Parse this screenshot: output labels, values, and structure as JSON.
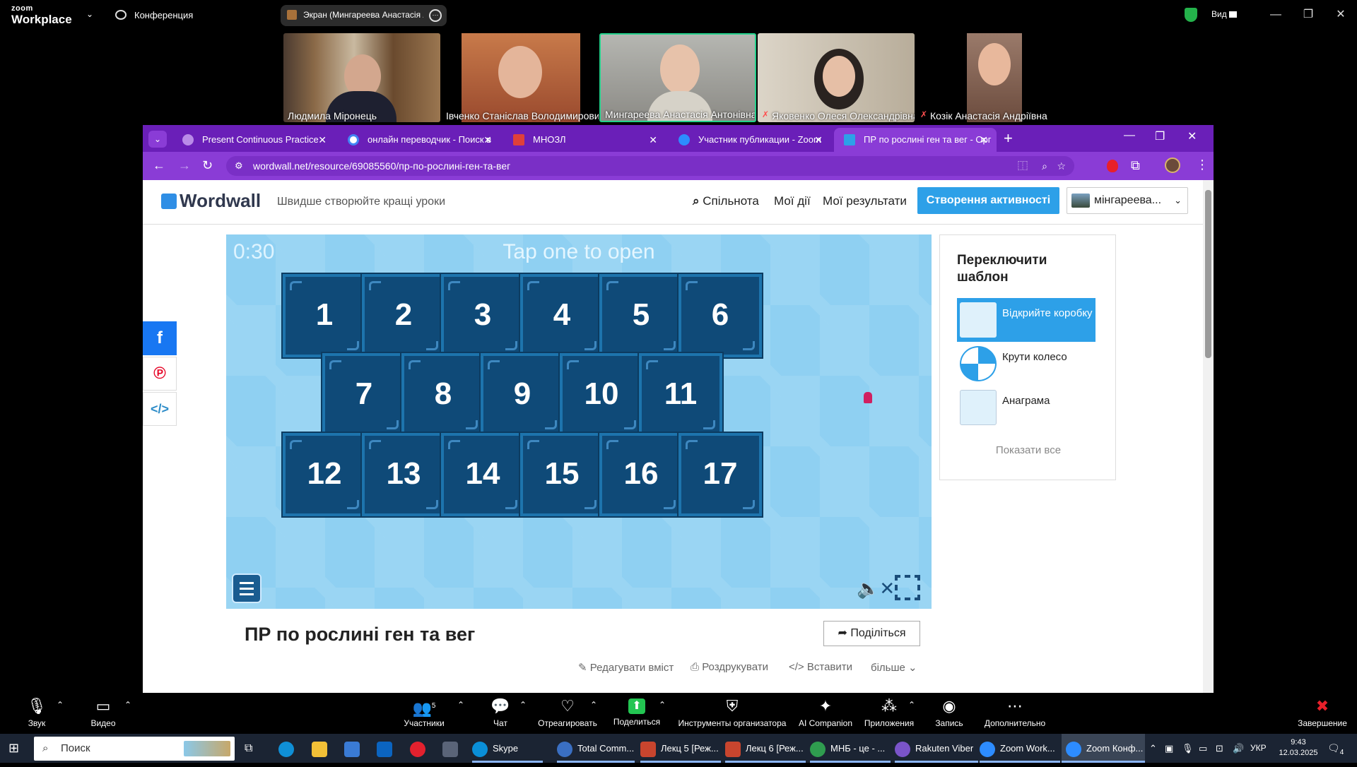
{
  "zoom": {
    "logo_line1": "zoom",
    "logo_line2": "Workplace",
    "meeting_label": "Конференция",
    "share_label": "Экран (Мингареева Анастасія А",
    "view_label": "Вид",
    "participants": [
      {
        "name": "Людмила Міронець"
      },
      {
        "name": "Івченко Станіслав Володимирович"
      },
      {
        "name": "Мингареева Анастасія Антонівна"
      },
      {
        "name": "Яковенко Олеся Олександрівна"
      },
      {
        "name": "Козік Анастасія Андріївна"
      }
    ],
    "controls": {
      "audio": "Звук",
      "video": "Видео",
      "participants": "Участники",
      "participants_count": "5",
      "chat": "Чат",
      "react": "Отреагировать",
      "share": "Поделиться",
      "host_tools": "Инструменты организатора",
      "ai": "AI Companion",
      "apps": "Приложения",
      "record": "Запись",
      "more": "Дополнительно",
      "end": "Завершение"
    }
  },
  "browser": {
    "tabs": [
      {
        "title": "Present Continuous Practice",
        "color": "#b98be8"
      },
      {
        "title": "онлайн переводчик - Поиск в",
        "color": "#ffffff"
      },
      {
        "title": "МНОЗЛ",
        "color": "#e0403a"
      },
      {
        "title": "Участник публикации - Zoom",
        "color": "#2d8cff"
      },
      {
        "title": "ПР по рослині ген та вег - Орг",
        "color": "#2da0e8"
      }
    ],
    "url": "wordwall.net/resource/69085560/пр-по-рослині-ген-та-вег"
  },
  "wordwall": {
    "logo": "Wordwall",
    "tagline": "Швидше створюйте кращі уроки",
    "nav_community": "Спільнота",
    "nav_my_activities": "Мої дії",
    "nav_my_results": "Мої результати",
    "create_button": "Створення активності",
    "user_button": "мінгареева...",
    "game": {
      "timer": "0:30",
      "prompt": "Tap one to open",
      "boxes": [
        "1",
        "2",
        "3",
        "4",
        "5",
        "6",
        "7",
        "8",
        "9",
        "10",
        "11",
        "12",
        "13",
        "14",
        "15",
        "16",
        "17"
      ]
    },
    "activity_title": "ПР по рослині ген та вег",
    "share_button": "Поділіться",
    "edit_link": "Редагувати вміст",
    "print_link": "Роздрукувати",
    "embed_link": "Вставити",
    "more_link": "більше",
    "switch_template": {
      "title": "Переключити шаблон",
      "options": [
        {
          "label": "Відкрийте коробку"
        },
        {
          "label": "Крути колесо"
        },
        {
          "label": "Анаграма"
        }
      ],
      "show_all": "Показати все"
    }
  },
  "taskbar": {
    "search": "Поиск",
    "items": [
      {
        "label": "Skype",
        "color": "#0a8fd8"
      },
      {
        "label": "Total Comm...",
        "color": "#3a6fc2"
      },
      {
        "label": "Лекц 5 [Реж...",
        "color": "#c8452e"
      },
      {
        "label": "Лекц 6 [Реж...",
        "color": "#c8452e"
      },
      {
        "label": "МНБ - це - ...",
        "color": "#2f9c4f"
      },
      {
        "label": "Rakuten Viber",
        "color": "#7a54c9"
      },
      {
        "label": "Zoom Work...",
        "color": "#2d8cff"
      },
      {
        "label": "Zoom Конф...",
        "color": "#2d8cff"
      }
    ],
    "language": "УКР",
    "time": "9:43",
    "date": "12.03.2025",
    "notifications": "4"
  }
}
